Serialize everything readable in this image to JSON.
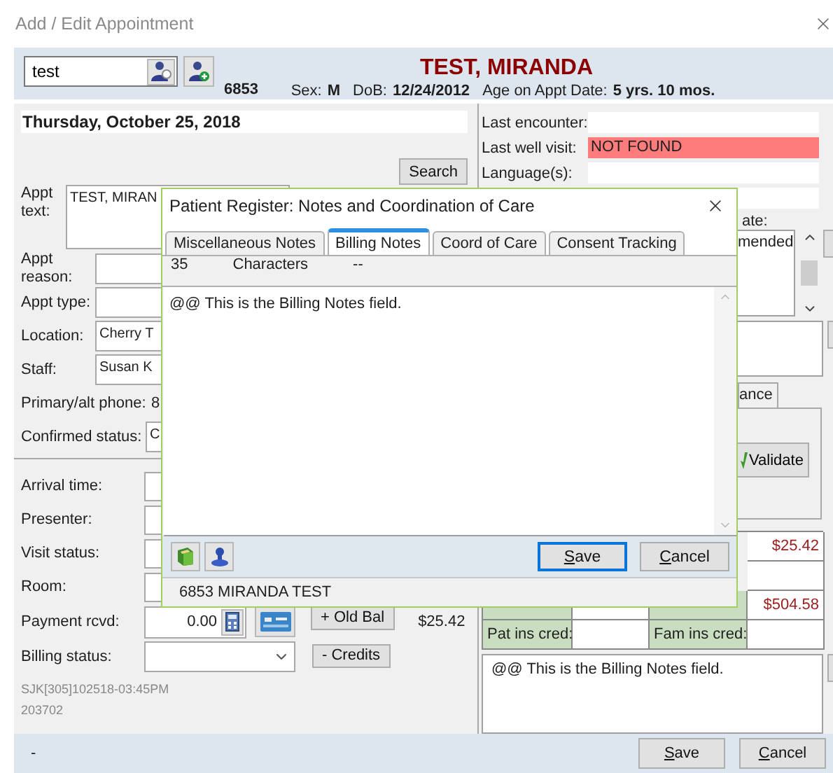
{
  "window": {
    "title": "Add / Edit Appointment"
  },
  "patient_search": {
    "value": "test"
  },
  "patient": {
    "id": "6853",
    "name": "TEST, MIRANDA",
    "sex_label": "Sex:",
    "sex": "M",
    "dob_label": "DoB:",
    "dob": "12/24/2012",
    "age_label": "Age on Appt Date:",
    "age": "5 yrs. 10 mos."
  },
  "appointment_date": "Thursday, October 25, 2018",
  "search_button": "Search",
  "left_fields": [
    {
      "label": "Appt text:",
      "value": "TEST, MIRAN",
      "kind": "textarea"
    },
    {
      "label": "Appt reason:",
      "kind": "input"
    },
    {
      "label": "Appt type:",
      "kind": "input"
    },
    {
      "label": "Location:",
      "value": "Cherry T",
      "kind": "input"
    },
    {
      "label": "Staff:",
      "value": "Susan K",
      "kind": "input"
    },
    {
      "label": "Primary/alt phone:",
      "value": "8",
      "kind": "text"
    },
    {
      "label": "Confirmed status:",
      "value": "C",
      "kind": "wide"
    }
  ],
  "visit_fields": [
    {
      "label": "Arrival time:"
    },
    {
      "label": "Presenter:"
    },
    {
      "label": "Visit status:"
    },
    {
      "label": "Room:"
    }
  ],
  "payment": {
    "label": "Payment rcvd:",
    "value": "0.00"
  },
  "billing_status": {
    "label": "Billing status:"
  },
  "balance_buttons": [
    "+ Old Bal",
    "- Credits"
  ],
  "balance_amount": "$25.42",
  "audit": [
    "SJK[305]102518-03:45PM",
    "203702"
  ],
  "summary": [
    {
      "label": "Last encounter:",
      "alert": false
    },
    {
      "label": "Last well visit:",
      "value": "NOT FOUND",
      "alert": true
    },
    {
      "label": "Language(s):",
      "alert": false
    }
  ],
  "right_partial": {
    "label": "ate:",
    "note": "mended",
    "tab": "ance",
    "validate": "Validate"
  },
  "balance_rows": [
    {
      "kind": "value_only",
      "right_value": "$25.42"
    },
    {
      "kind": "value_only"
    },
    {
      "kind": "full",
      "right_value": "$504.58"
    },
    {
      "kind": "full",
      "left_label": "Pat ins cred:",
      "right_label": "Fam ins cred:"
    }
  ],
  "billing_notes_preview": "@@ This is the Billing Notes field.",
  "footer_text": "-",
  "buttons": [
    {
      "label": "Save",
      "default": false
    },
    {
      "label": "Cancel",
      "default": false
    }
  ],
  "dialog": {
    "title": "Patient Register: Notes and Coordination of Care",
    "tabs": [
      {
        "label": "Miscellaneous Notes",
        "selected": false
      },
      {
        "label": "Billing Notes",
        "selected": true
      },
      {
        "label": "Coord of Care",
        "selected": false
      },
      {
        "label": "Consent Tracking",
        "selected": false
      }
    ],
    "char_count": "35",
    "char_label": "Characters",
    "char_extra": "--",
    "notes": "@@ This is the Billing Notes field.",
    "buttons": [
      {
        "label": "Save",
        "default": true
      },
      {
        "label": "Cancel",
        "default": false
      }
    ],
    "status": "6853 MIRANDA TEST"
  }
}
